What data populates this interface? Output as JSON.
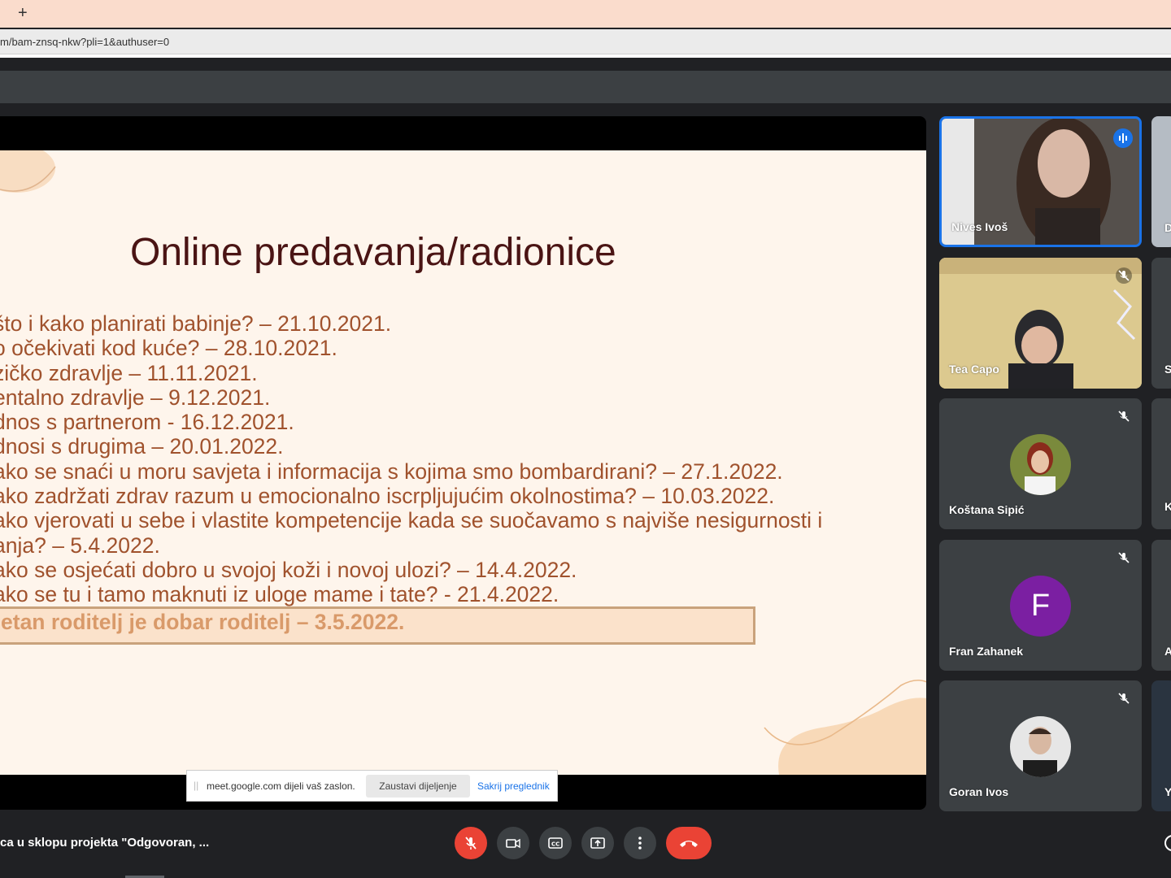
{
  "browser": {
    "new_tab_icon": "+",
    "url": "m/bam-znsq-nkw?pli=1&authuser=0"
  },
  "slide": {
    "title": "Online predavanja/radionice",
    "items": [
      "što i kako planirati babinje? – 21.10.2021.",
      "o očekivati kod kuće? – 28.10.2021.",
      "zičko zdravlje – 11.11.2021.",
      "entalno zdravlje – 9.12.2021.",
      "dnos s partnerom  - 16.12.2021.",
      "dnosi s drugima – 20.01.2022.",
      "ako se snaći u moru savjeta i informacija s kojima smo bombardirani? – 27.1.2022.",
      "ako zadržati zdrav razum u emocionalno iscrpljujućim okolnostima? – 10.03.2022.",
      "ako vjerovati u sebe i vlastite kompetencije kada se suočavamo s najviše nesigurnosti i",
      "anja? – 5.4.2022.",
      "ako se osjećati dobro u svojoj koži i novoj ulozi? – 14.4.2022.",
      "ako se tu i tamo maknuti iz uloge mame i tate?  - 21.4.2022."
    ],
    "highlighted_item": "etan roditelj je dobar roditelj – 3.5.2022."
  },
  "share_bar": {
    "message": "meet.google.com dijeli vaš zaslon.",
    "stop_label": "Zaustavi dijeljenje",
    "hide_label": "Sakrij preglednik"
  },
  "participants": [
    {
      "name": "Nives Ivoš",
      "speaking": true
    },
    {
      "name": "Tea Capo",
      "muted": true
    },
    {
      "name": "Koštana Sipić",
      "muted": true
    },
    {
      "name": "Fran Zahanek",
      "muted": true,
      "initial": "F",
      "avatar_color": "#7b1fa2"
    },
    {
      "name": "Goran Ivos",
      "muted": true
    }
  ],
  "partial_participants": [
    {
      "name": "D"
    },
    {
      "name": "Sa"
    },
    {
      "name": "K"
    },
    {
      "name": "Ar"
    },
    {
      "name": "Y"
    }
  ],
  "bottom_bar": {
    "meeting_title": "ca u sklopu projekta \"Odgovoran, ..."
  },
  "colors": {
    "accent_blue": "#1a73e8",
    "danger_red": "#ea4335",
    "slide_title": "#4a1414",
    "slide_text": "#a0522d"
  }
}
